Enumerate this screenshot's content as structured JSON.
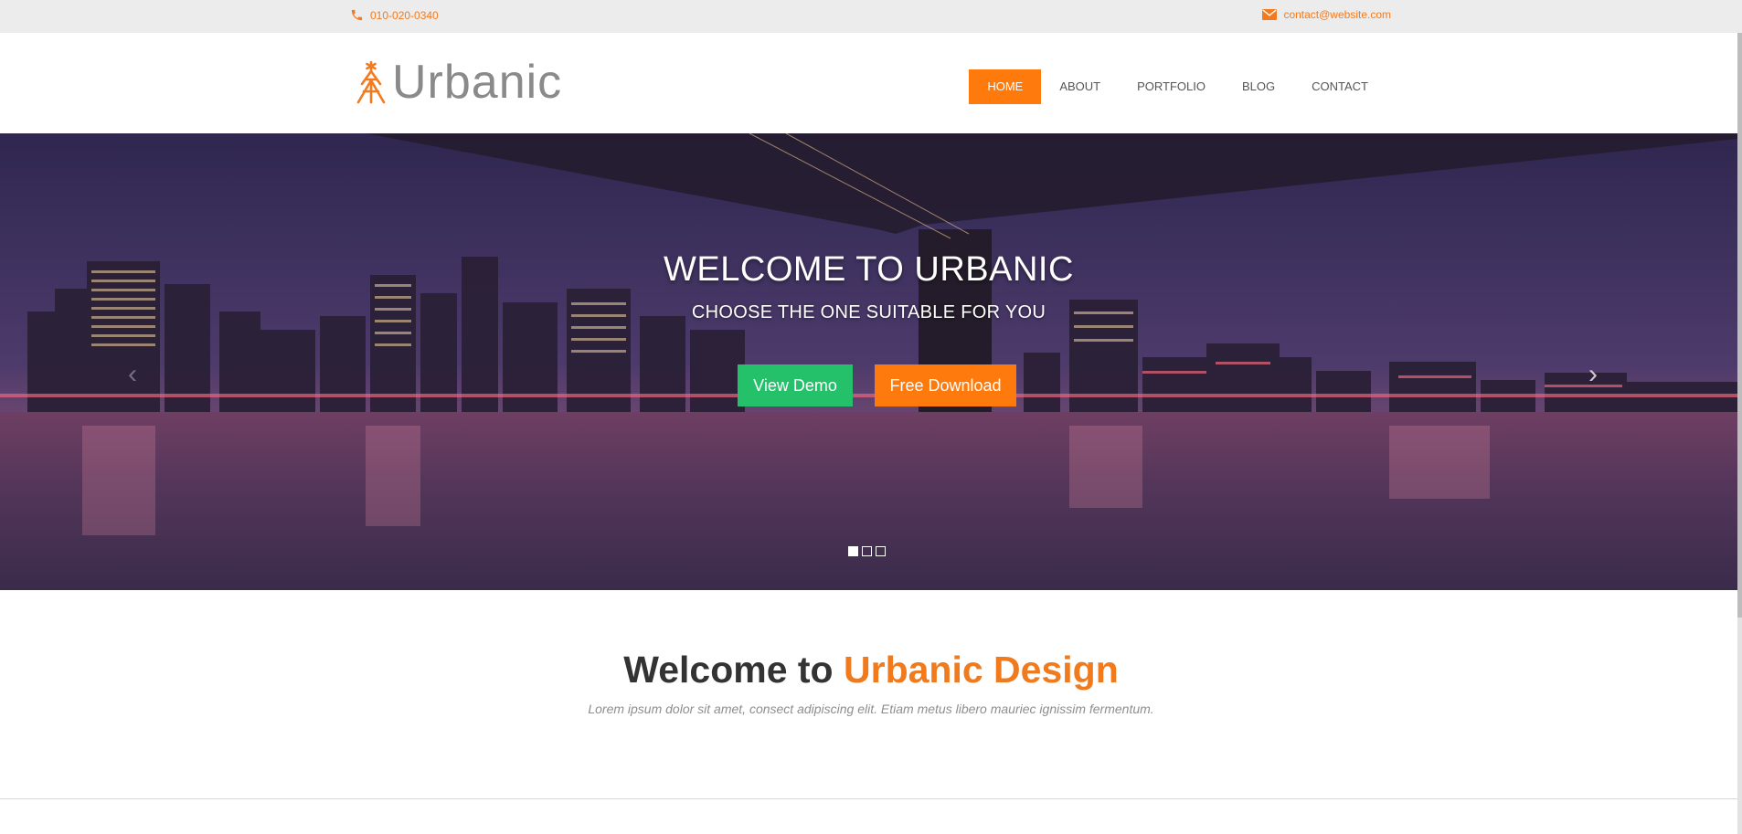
{
  "topbar": {
    "phone": "010-020-0340",
    "email": "contact@website.com",
    "phone_icon": "phone-icon",
    "email_icon": "envelope-icon"
  },
  "logo": {
    "text": "Urbanic",
    "icon": "tree-logo-icon"
  },
  "nav": {
    "items": [
      {
        "label": "HOME",
        "active": true
      },
      {
        "label": "ABOUT",
        "active": false
      },
      {
        "label": "PORTFOLIO",
        "active": false
      },
      {
        "label": "BLOG",
        "active": false
      },
      {
        "label": "CONTACT",
        "active": false
      }
    ]
  },
  "hero": {
    "title": "WELCOME TO URBANIC",
    "subtitle": "CHOOSE THE ONE SUITABLE FOR YOU",
    "demo_button": "View Demo",
    "download_button": "Free Download",
    "prev_arrow": "‹",
    "next_arrow": "›",
    "slides": 3,
    "active_slide": 1
  },
  "welcome": {
    "heading_plain": "Welcome to ",
    "heading_accent": "Urbanic Design",
    "tagline": "Lorem ipsum dolor sit amet, consect adipiscing elit. Etiam metus libero mauriec ignissim fermentum."
  },
  "colors": {
    "accent": "#ff7a0c",
    "green": "#25c06a",
    "topbar_bg": "#ececec",
    "text_orange": "#ef7b1e"
  }
}
